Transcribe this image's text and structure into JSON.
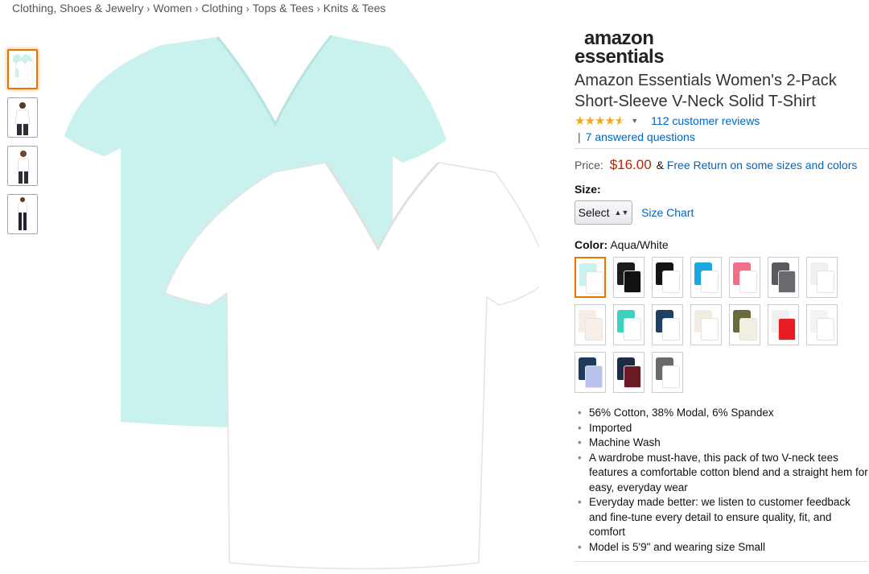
{
  "breadcrumb": [
    "Clothing, Shoes & Jewelry",
    "Women",
    "Clothing",
    "Tops & Tees",
    "Knits & Tees"
  ],
  "breadcrumb_separator": "›",
  "thumbnails": [
    {
      "name": "thumb-product-front",
      "active": true
    },
    {
      "name": "thumb-model-front",
      "active": false
    },
    {
      "name": "thumb-model-side",
      "active": false
    },
    {
      "name": "thumb-model-full",
      "active": false
    }
  ],
  "product": {
    "brand_line1": "amazon",
    "brand_line2": "essentials",
    "title": "Amazon Essentials Women's 2-Pack Short-Sleeve V-Neck Solid T-Shirt",
    "rating_value": 4.5,
    "rating_stars": "★★★★",
    "reviews_link": "112 customer reviews",
    "qa_pipe": "|",
    "qa_link": "7 answered questions",
    "price_label": "Price:",
    "price": "$16.00",
    "price_amp": "&",
    "free_return": "Free Return on some sizes and colors",
    "size_label": "Size:",
    "size_select": "Select",
    "size_chart": "Size Chart",
    "color_label": "Color:",
    "color_value": "Aqua/White"
  },
  "swatches": [
    {
      "back": "#c9f1ee",
      "front": "#ffffff",
      "selected": true
    },
    {
      "back": "#1c1c1c",
      "front": "#111111",
      "selected": false
    },
    {
      "back": "#141414",
      "front": "#ffffff",
      "selected": false
    },
    {
      "back": "#1aa8e0",
      "front": "#ffffff",
      "selected": false
    },
    {
      "back": "#f0708a",
      "front": "#ffffff",
      "selected": false
    },
    {
      "back": "#5a5a5e",
      "front": "#6a6a6e",
      "selected": false
    },
    {
      "back": "#f0f0f0",
      "front": "#ffffff",
      "selected": false
    },
    {
      "back": "#f4ede8",
      "front": "#f7efe8",
      "selected": false
    },
    {
      "back": "#3ed1c0",
      "front": "#ffffff",
      "selected": false
    },
    {
      "back": "#1f3f63",
      "front": "#ffffff",
      "selected": false
    },
    {
      "back": "#f3ece2",
      "front": "#ffffff",
      "selected": false
    },
    {
      "back": "#6b6a3c",
      "front": "#f3efe2",
      "selected": false
    },
    {
      "back": "#f0f0f0",
      "front": "#e81c24",
      "selected": false
    },
    {
      "back": "#f3f3f3",
      "front": "#ffffff",
      "selected": false
    },
    {
      "back": "#1e3a5c",
      "front": "#b8c2ef",
      "selected": false
    },
    {
      "back": "#1d2b45",
      "front": "#6b1a24",
      "selected": false
    },
    {
      "back": "#6a6a6a",
      "front": "#ffffff",
      "selected": false
    }
  ],
  "bullets": [
    "56% Cotton, 38% Modal, 6% Spandex",
    "Imported",
    "Machine Wash",
    "A wardrobe must-have, this pack of two V-neck tees features a comfortable cotton blend and a straight hem for easy, everyday wear",
    "Everyday made better: we listen to customer feedback and fine-tune every detail to ensure quality, fit, and comfort",
    "Model is 5'9\" and wearing size Small"
  ]
}
